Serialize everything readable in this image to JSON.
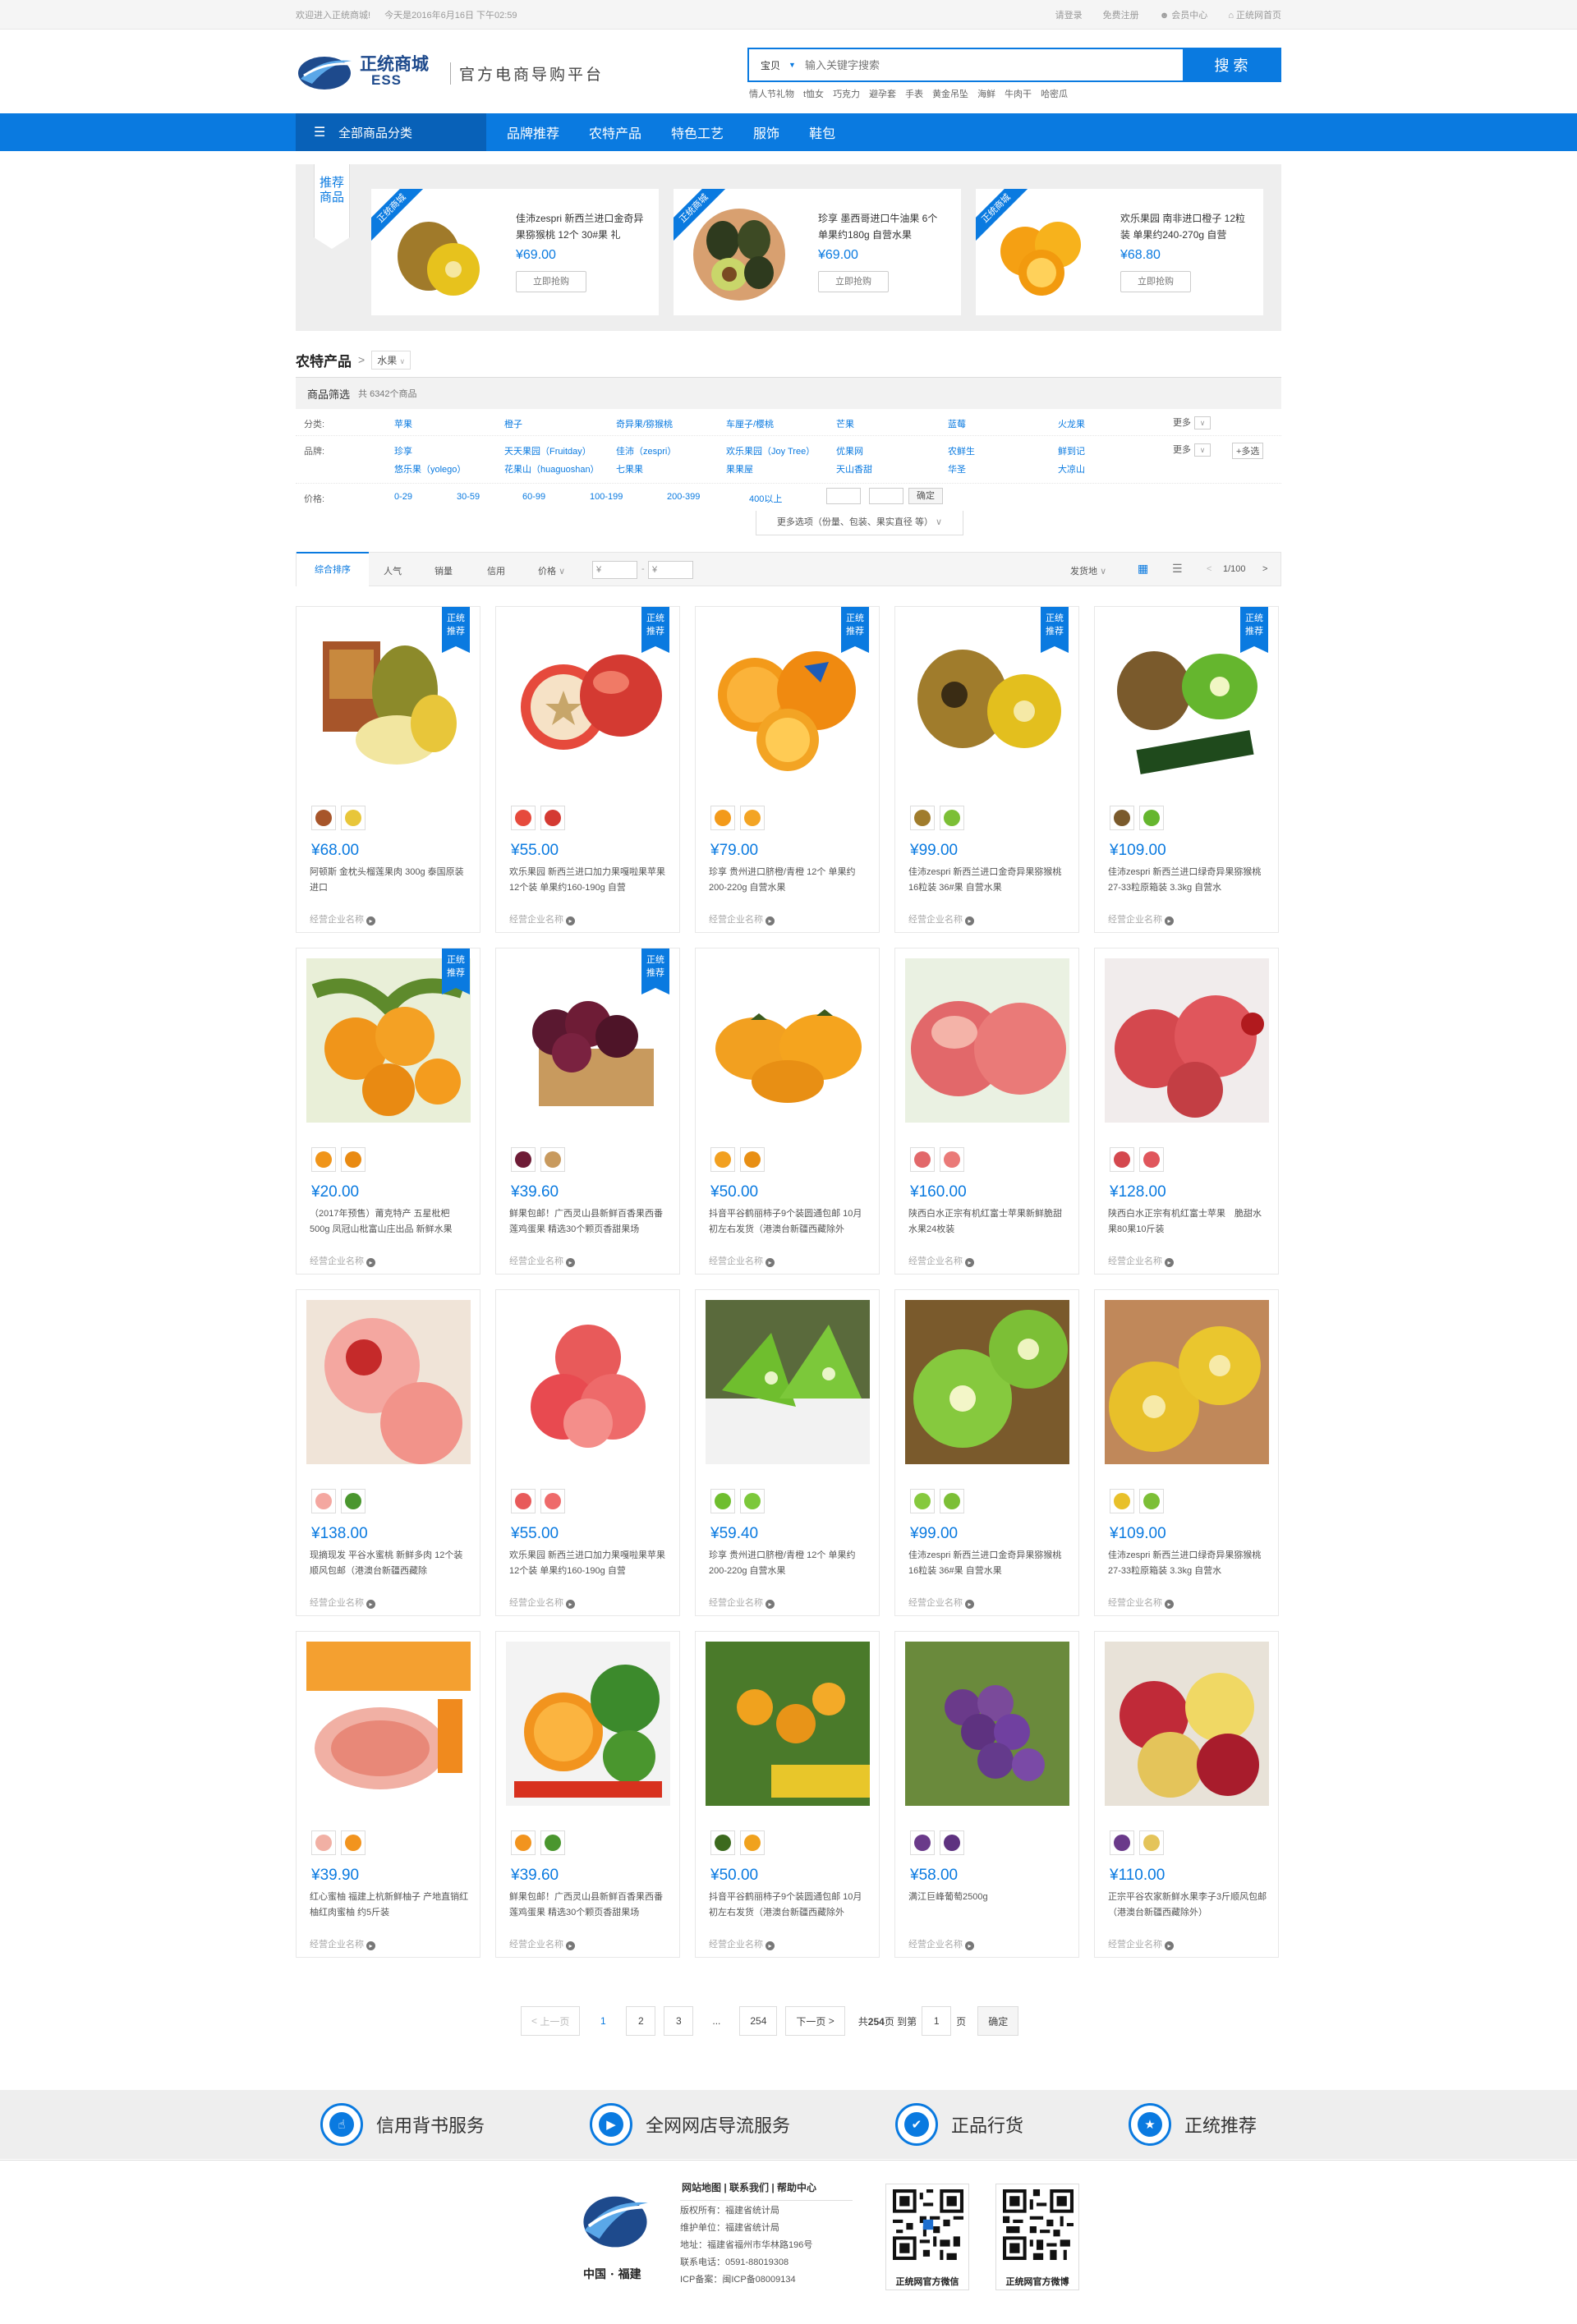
{
  "topbar": {
    "welcome": "欢迎进入正统商城!",
    "today": "今天是2016年6月16日 下午02:59",
    "links": [
      "请登录",
      "免费注册",
      "会员中心",
      "正统网首页"
    ]
  },
  "header": {
    "logo_cn": "正统商城",
    "logo_en": "ESS",
    "slogan": "官方电商导购平台",
    "search_category": "宝贝",
    "search_placeholder": "输入关键字搜索",
    "search_button": "搜 索",
    "hotwords": [
      "情人节礼物",
      "t恤女",
      "巧克力",
      "避孕套",
      "手表",
      "黄金吊坠",
      "海鲜",
      "牛肉干",
      "哈密瓜"
    ]
  },
  "nav": {
    "all_categories": "全部商品分类",
    "items": [
      "品牌推荐",
      "农特产品",
      "特色工艺",
      "服饰",
      "鞋包"
    ]
  },
  "recommend": {
    "tag": "推荐商品",
    "ribbon": "正统商城",
    "buy_label": "立即抢购",
    "items": [
      {
        "name": "佳沛zespri 新西兰进口金奇异果猕猴桃 12个 30#果 礼",
        "price": "¥69.00"
      },
      {
        "name": "珍享 墨西哥进口牛油果 6个 单果约180g 自营水果",
        "price": "¥69.00"
      },
      {
        "name": "欢乐果园 南非进口橙子 12粒装 单果约240-270g 自营",
        "price": "¥68.80"
      }
    ]
  },
  "breadcrumb": {
    "section": "农特产品",
    "arrow": ">",
    "category": "水果"
  },
  "filter": {
    "title": "商品筛选",
    "count": "共 6342个商品",
    "category_label": "分类:",
    "categories": [
      "苹果",
      "橙子",
      "奇异果/猕猴桃",
      "车厘子/樱桃",
      "芒果",
      "蓝莓",
      "火龙果"
    ],
    "brand_label": "品牌:",
    "brands_row1": [
      "珍享",
      "天天果园（Fruitday）",
      "佳沛（zespri）",
      "欢乐果园（Joy Tree）",
      "优果网",
      "农鲜生",
      "鲜到记"
    ],
    "brands_row2": [
      "悠乐果（yolego）",
      "花果山（huaguoshan）",
      "七果果",
      "果果屋",
      "天山香甜",
      "华圣",
      "大凉山"
    ],
    "price_label": "价格:",
    "prices": [
      "0-29",
      "30-59",
      "60-99",
      "100-199",
      "200-399",
      "400以上"
    ],
    "confirm": "确定",
    "more": "更多",
    "multi": "+多选",
    "more_options": "更多选项（份量、包装、果实直径 等）"
  },
  "sortbar": {
    "items": [
      "综合排序",
      "人气",
      "销量",
      "信用",
      "价格"
    ],
    "price_from": "¥",
    "price_to": "¥",
    "ship_from": "发货地",
    "page_info": "1/100"
  },
  "badge": "正统推荐",
  "shop_label": "经营企业名称",
  "products": [
    {
      "price": "¥68.00",
      "title": "阿顿斯 金枕头榴莲果肉 300g 泰国原装进口",
      "badge": true
    },
    {
      "price": "¥55.00",
      "title": "欢乐果园 新西兰进口加力果嘎啦果苹果 12个装 单果约160-190g 自营",
      "badge": true
    },
    {
      "price": "¥79.00",
      "title": "珍享 贵州进口脐橙/青橙 12个 单果约200-220g 自营水果",
      "badge": true
    },
    {
      "price": "¥99.00",
      "title": "佳沛zespri 新西兰进口金奇异果猕猴桃 16粒装 36#果 自营水果",
      "badge": true
    },
    {
      "price": "¥109.00",
      "title": "佳沛zespri 新西兰进口绿奇异果猕猴桃 27-33粒原箱装 3.3kg 自营水",
      "badge": true
    },
    {
      "price": "¥20.00",
      "title": "（2017年预售）莆克特产 五星枇杷 500g 凤冠山枇富山庄出品 新鲜水果",
      "badge": true
    },
    {
      "price": "¥39.60",
      "title": "鲜果包邮！广西灵山县新鲜百香果西番莲鸡蛋果 精选30个颗页香甜果场",
      "badge": true
    },
    {
      "price": "¥50.00",
      "title": "抖音平谷鹤丽柿子9个装圆通包邮 10月初左右发货（港澳台新疆西藏除外",
      "badge": false
    },
    {
      "price": "¥160.00",
      "title": "陕西白水正宗有机红富士苹果新鲜脆甜水果24枚装",
      "badge": false
    },
    {
      "price": "¥128.00",
      "title": "陕西白水正宗有机红富士苹果　脆甜水果80果10斤装",
      "badge": false
    },
    {
      "price": "¥138.00",
      "title": "现摘现发 平谷水蜜桃 新鲜多肉 12个装 顺风包邮（港澳台新疆西藏除",
      "badge": false
    },
    {
      "price": "¥55.00",
      "title": "欢乐果园 新西兰进口加力果嘎啦果苹果 12个装 单果约160-190g 自营",
      "badge": false
    },
    {
      "price": "¥59.40",
      "title": "珍享 贵州进口脐橙/青橙 12个 单果约200-220g 自营水果",
      "badge": false
    },
    {
      "price": "¥99.00",
      "title": "佳沛zespri 新西兰进口金奇异果猕猴桃 16粒装 36#果 自营水果",
      "badge": false
    },
    {
      "price": "¥109.00",
      "title": "佳沛zespri 新西兰进口绿奇异果猕猴桃 27-33粒原箱装 3.3kg 自营水",
      "badge": false
    },
    {
      "price": "¥39.90",
      "title": "红心蜜柚 福建上杭新鲜柚子 产地直销红柚红肉蜜柚 约5斤装",
      "badge": false
    },
    {
      "price": "¥39.60",
      "title": "鲜果包邮！广西灵山县新鲜百香果西番莲鸡蛋果 精选30个颗页香甜果场",
      "badge": false
    },
    {
      "price": "¥50.00",
      "title": "抖音平谷鹤丽柿子9个装圆通包邮 10月初左右发货（港澳台新疆西藏除外",
      "badge": false
    },
    {
      "price": "¥58.00",
      "title": "满江巨峰葡萄2500g",
      "badge": false
    },
    {
      "price": "¥110.00",
      "title": "正宗平谷农家新鲜水果李子3斤顺风包邮（港澳台新疆西藏除外）",
      "badge": false
    }
  ],
  "pager": {
    "prev": "上一页",
    "pages": [
      "1",
      "2",
      "3"
    ],
    "dots": "...",
    "last": "254",
    "next": "下一页",
    "total_pre": "共",
    "total_num": "254",
    "total_post": "页 到第",
    "goto_value": "1",
    "goto_post": "页",
    "confirm": "确定"
  },
  "services": [
    "信用背书服务",
    "全网网店导流服务",
    "正品行货",
    "正统推荐"
  ],
  "footer": {
    "region": "中国 · 福建",
    "links": "网站地图 | 联系我们 | 帮助中心",
    "info": [
      "版权所有：福建省统计局",
      "维护单位：福建省统计局",
      "地址：福建省福州市华林路196号",
      "联系电话：0591-88019308",
      "ICP备案：闽ICP备08009134"
    ],
    "qr1": "正统网官方微信",
    "qr2": "正统网官方微博"
  },
  "colors": {
    "accent": "#0a7ae0",
    "nav_dark": "#0861b8",
    "brand_logo": "#1e4a8c"
  }
}
